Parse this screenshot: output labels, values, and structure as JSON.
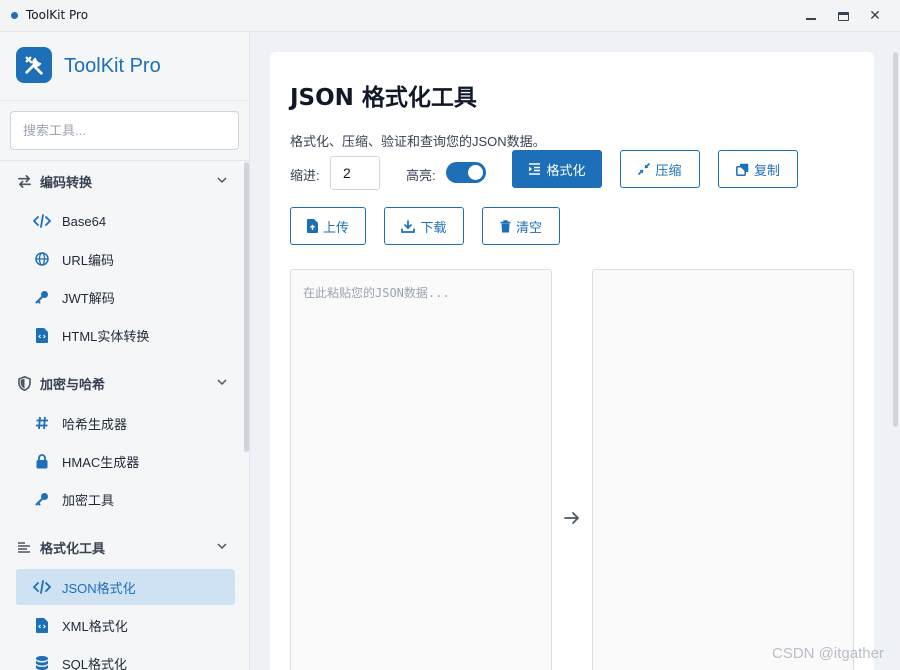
{
  "window": {
    "title": "ToolKit Pro",
    "controls": {
      "minimize": "minimize",
      "maximize": "maximize",
      "close": "✕"
    }
  },
  "sidebar": {
    "brand": "ToolKit Pro",
    "search_placeholder": "搜索工具...",
    "groups": [
      {
        "label": "编码转换",
        "icon": "swap-arrows-icon",
        "expanded": true,
        "items": [
          {
            "label": "Base64",
            "icon": "code-icon"
          },
          {
            "label": "URL编码",
            "icon": "globe-icon"
          },
          {
            "label": "JWT解码",
            "icon": "key-icon"
          },
          {
            "label": "HTML实体转换",
            "icon": "file-code-icon"
          }
        ]
      },
      {
        "label": "加密与哈希",
        "icon": "shield-icon",
        "expanded": true,
        "items": [
          {
            "label": "哈希生成器",
            "icon": "hash-icon"
          },
          {
            "label": "HMAC生成器",
            "icon": "lock-icon"
          },
          {
            "label": "加密工具",
            "icon": "key-icon"
          }
        ]
      },
      {
        "label": "格式化工具",
        "icon": "align-left-icon",
        "expanded": true,
        "items": [
          {
            "label": "JSON格式化",
            "icon": "code-icon",
            "active": true
          },
          {
            "label": "XML格式化",
            "icon": "file-code-icon"
          },
          {
            "label": "SQL格式化",
            "icon": "database-icon"
          }
        ]
      }
    ]
  },
  "main": {
    "title": "JSON 格式化工具",
    "description": "格式化、压缩、验证和查询您的JSON数据。",
    "indent_label": "缩进:",
    "indent_value": "2",
    "highlight_label": "高亮:",
    "highlight_on": true,
    "buttons": {
      "format": "格式化",
      "compress": "压缩",
      "copy": "复制",
      "upload": "上传",
      "download": "下载",
      "clear": "清空"
    },
    "input_placeholder": "在此粘贴您的JSON数据...",
    "output_value": ""
  },
  "watermark": "CSDN @itgather",
  "colors": {
    "accent": "#1d6fb8",
    "active_item_bg": "#cfe2f3",
    "sidebar_bg": "#f4f6f8",
    "page_bg": "#eef2f6"
  }
}
